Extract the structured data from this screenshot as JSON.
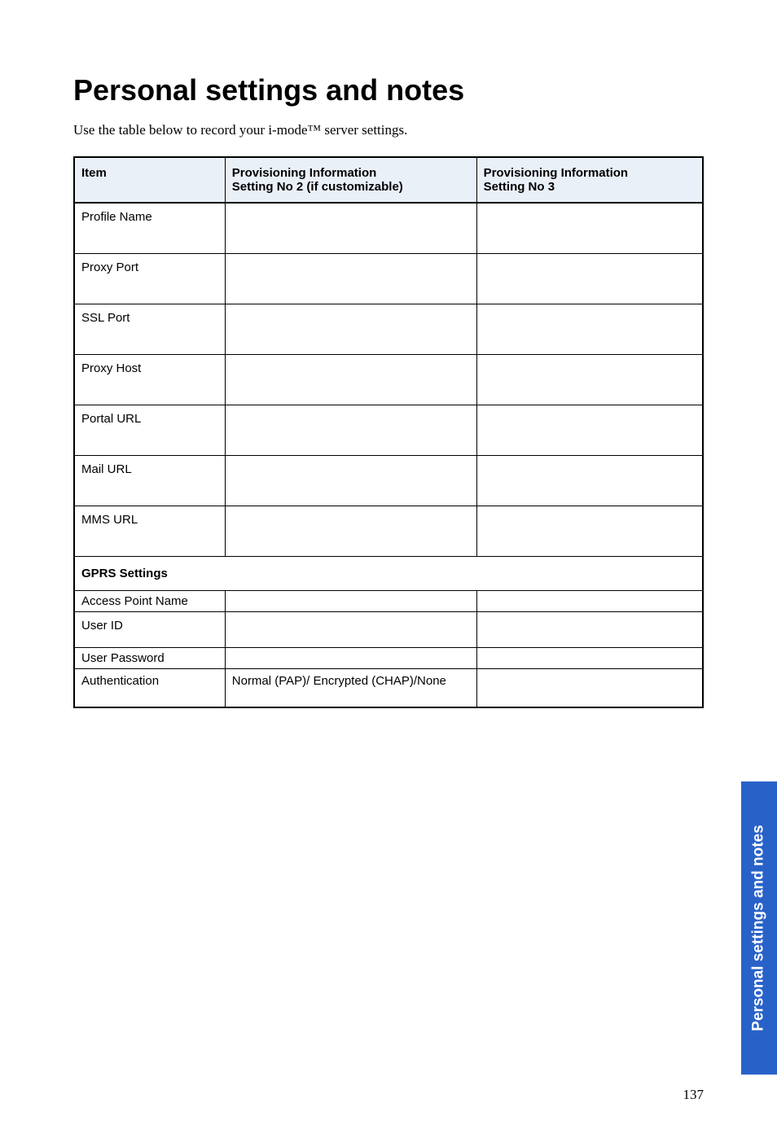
{
  "title": "Personal settings and notes",
  "intro": "Use the table below to record your i-mode™ server settings.",
  "headers": {
    "item": "Item",
    "col2a": "Provisioning Information",
    "col2b": "Setting No 2 (if customizable)",
    "col3a": "Provisioning Information",
    "col3b": "Setting No 3"
  },
  "rows": {
    "profile_name": "Profile Name",
    "proxy_port": "Proxy Port",
    "ssl_port": "SSL Port",
    "proxy_host": "Proxy Host",
    "portal_url": "Portal URL",
    "mail_url": "Mail URL",
    "mms_url": "MMS URL",
    "gprs_settings": "GPRS Settings",
    "access_point_name": "Access Point Name",
    "user_id": "User ID",
    "user_password": "User Password",
    "authentication": "Authentication",
    "auth_val": "Normal (PAP)/ Encrypted (CHAP)/None"
  },
  "side_tab": "Personal settings and notes",
  "page_number": "137"
}
